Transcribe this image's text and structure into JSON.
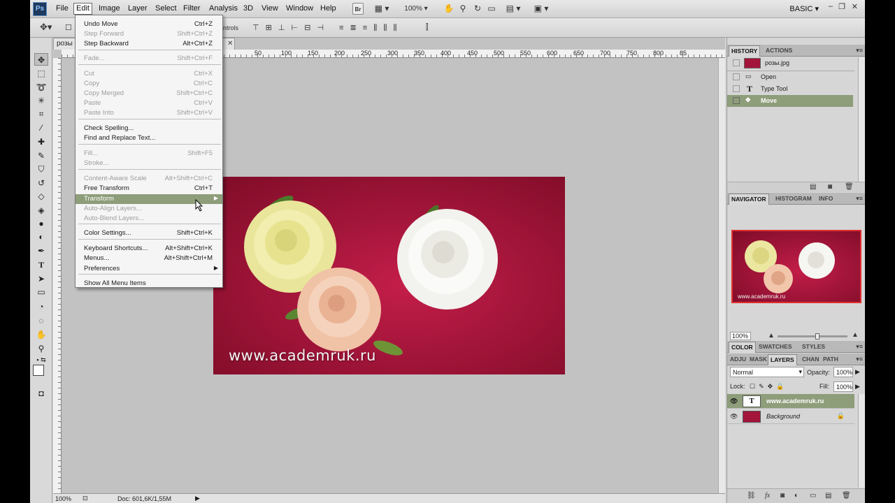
{
  "menubar": {
    "logo": "Ps",
    "items": [
      "File",
      "Edit",
      "Image",
      "Layer",
      "Select",
      "Filter",
      "Analysis",
      "3D",
      "View",
      "Window",
      "Help"
    ],
    "bridge_label": "Br",
    "zoom": "100%",
    "workspace": "BASIC"
  },
  "options": {
    "controls_label": "ntrols"
  },
  "document": {
    "tab_title": "розы",
    "ruler_numbers": [
      "50",
      "100",
      "150",
      "200",
      "250",
      "300",
      "350",
      "400",
      "450",
      "500",
      "550",
      "600",
      "650",
      "700",
      "750",
      "800",
      "85"
    ],
    "watermark": "www.academruk.ru",
    "status_zoom": "100%",
    "status_doc": "Doc: 601,6K/1,55M"
  },
  "edit_menu": {
    "items": [
      {
        "label": "Undo Move",
        "shortcut": "Ctrl+Z",
        "disabled": false
      },
      {
        "label": "Step Forward",
        "shortcut": "Shift+Ctrl+Z",
        "disabled": true
      },
      {
        "label": "Step Backward",
        "shortcut": "Alt+Ctrl+Z",
        "disabled": false
      },
      {
        "label": "Fade...",
        "shortcut": "Shift+Ctrl+F",
        "disabled": true
      },
      {
        "label": "Cut",
        "shortcut": "Ctrl+X",
        "disabled": true
      },
      {
        "label": "Copy",
        "shortcut": "Ctrl+C",
        "disabled": true
      },
      {
        "label": "Copy Merged",
        "shortcut": "Shift+Ctrl+C",
        "disabled": true
      },
      {
        "label": "Paste",
        "shortcut": "Ctrl+V",
        "disabled": true
      },
      {
        "label": "Paste Into",
        "shortcut": "Shift+Ctrl+V",
        "disabled": true
      },
      {
        "label": "Check Spelling...",
        "shortcut": "",
        "disabled": false
      },
      {
        "label": "Find and Replace Text...",
        "shortcut": "",
        "disabled": false
      },
      {
        "label": "Fill...",
        "shortcut": "Shift+F5",
        "disabled": true
      },
      {
        "label": "Stroke...",
        "shortcut": "",
        "disabled": true
      },
      {
        "label": "Content-Aware Scale",
        "shortcut": "Alt+Shift+Ctrl+C",
        "disabled": true
      },
      {
        "label": "Free Transform",
        "shortcut": "Ctrl+T",
        "disabled": false
      },
      {
        "label": "Transform",
        "shortcut": "",
        "disabled": false
      },
      {
        "label": "Auto-Align Layers...",
        "shortcut": "",
        "disabled": true
      },
      {
        "label": "Auto-Blend Layers...",
        "shortcut": "",
        "disabled": true
      },
      {
        "label": "Color Settings...",
        "shortcut": "Shift+Ctrl+K",
        "disabled": false
      },
      {
        "label": "Keyboard Shortcuts...",
        "shortcut": "Alt+Shift+Ctrl+K",
        "disabled": false
      },
      {
        "label": "Menus...",
        "shortcut": "Alt+Shift+Ctrl+M",
        "disabled": false
      },
      {
        "label": "Preferences",
        "shortcut": "",
        "disabled": false
      },
      {
        "label": "Show All Menu Items",
        "shortcut": "",
        "disabled": false
      }
    ]
  },
  "history_panel": {
    "tabs": [
      "HISTORY",
      "ACTIONS"
    ],
    "snapshot": "розы.jpg",
    "states": [
      "Open",
      "Type Tool",
      "Move"
    ]
  },
  "navigator_panel": {
    "tabs": [
      "NAVIGATOR",
      "HISTOGRAM",
      "INFO"
    ],
    "zoom": "100%",
    "watermark": "www.academruk.ru"
  },
  "color_panel": {
    "tabs": [
      "COLOR",
      "SWATCHES",
      "STYLES"
    ]
  },
  "layers_panel": {
    "tabs": [
      "ADJU",
      "MASK",
      "LAYERS",
      "CHAN",
      "PATH"
    ],
    "blend_mode": "Normal",
    "opacity_label": "Opacity:",
    "opacity": "100%",
    "lock_label": "Lock:",
    "fill_label": "Fill:",
    "fill": "100%",
    "layers": [
      {
        "name": "www.academruk.ru",
        "type": "text",
        "thumb_glyph": "T"
      },
      {
        "name": "Background",
        "type": "image"
      }
    ]
  }
}
